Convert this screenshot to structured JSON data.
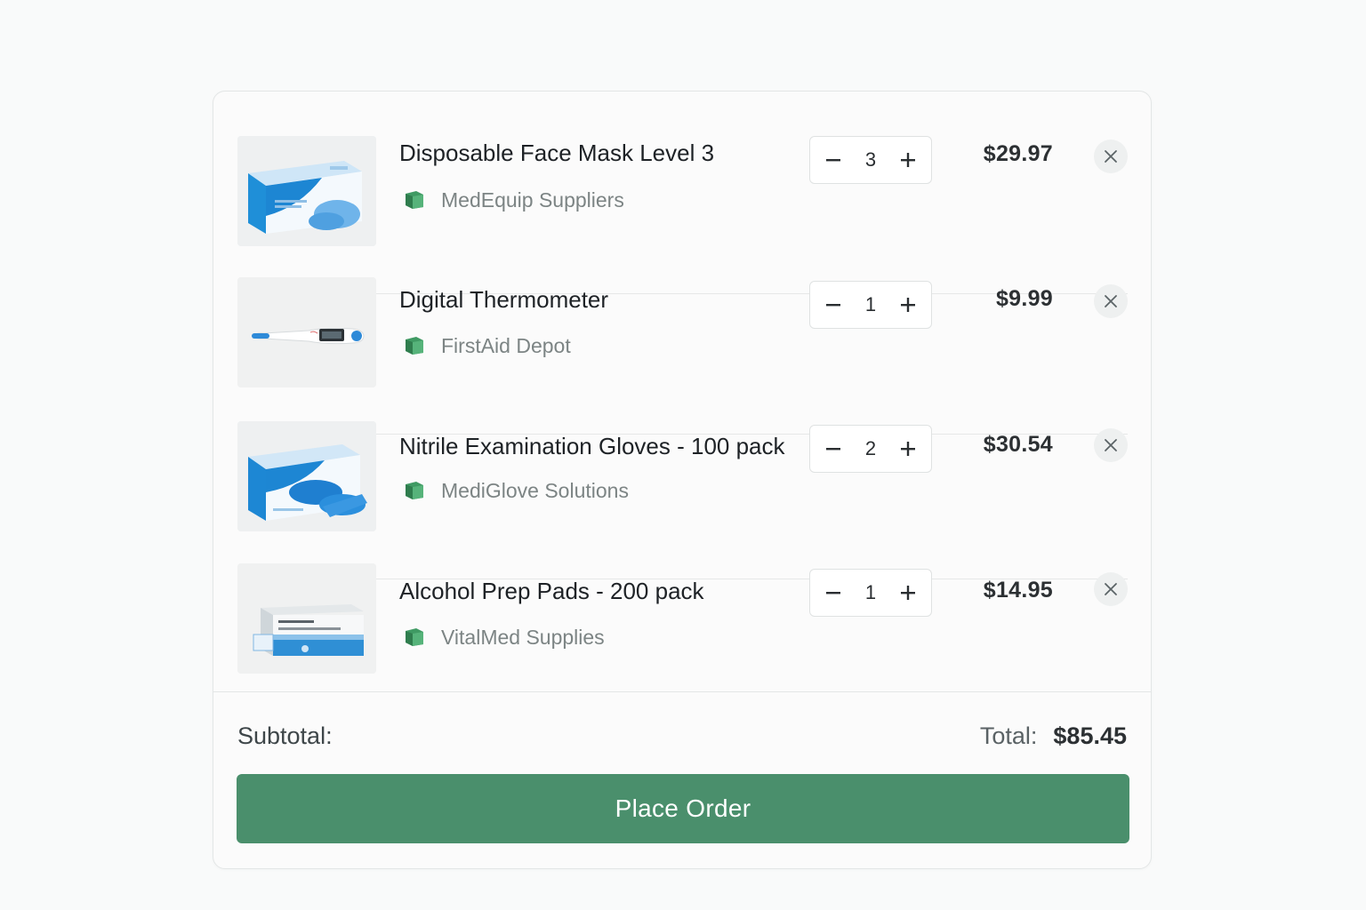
{
  "cart": {
    "items": [
      {
        "title": "Disposable Face Mask Level 3",
        "supplier": "MedEquip Suppliers",
        "quantity": "3",
        "price": "$29.97",
        "image_icon": "face-mask-box-image"
      },
      {
        "title": "Digital Thermometer",
        "supplier": "FirstAid Depot",
        "quantity": "1",
        "price": "$9.99",
        "image_icon": "thermometer-image"
      },
      {
        "title": "Nitrile Examination Gloves - 100 pack",
        "supplier": "MediGlove Solutions",
        "quantity": "2",
        "price": "$30.54",
        "image_icon": "gloves-box-image"
      },
      {
        "title": "Alcohol Prep Pads - 200 pack",
        "supplier": "VitalMed Supplies",
        "quantity": "1",
        "price": "$14.95",
        "image_icon": "prep-pads-box-image"
      }
    ],
    "icons": {
      "supplier": "supplier-box-icon",
      "decrement": "minus-icon",
      "increment": "plus-icon",
      "remove": "close-icon"
    }
  },
  "summary": {
    "subtotal_label": "Subtotal:",
    "total_label": "Total:",
    "total_value": "$85.45"
  },
  "actions": {
    "place_order_label": "Place Order"
  },
  "colors": {
    "primary_button": "#4a8f6c",
    "supplier_icon": "#3f9a63",
    "background": "#f9fafa"
  }
}
